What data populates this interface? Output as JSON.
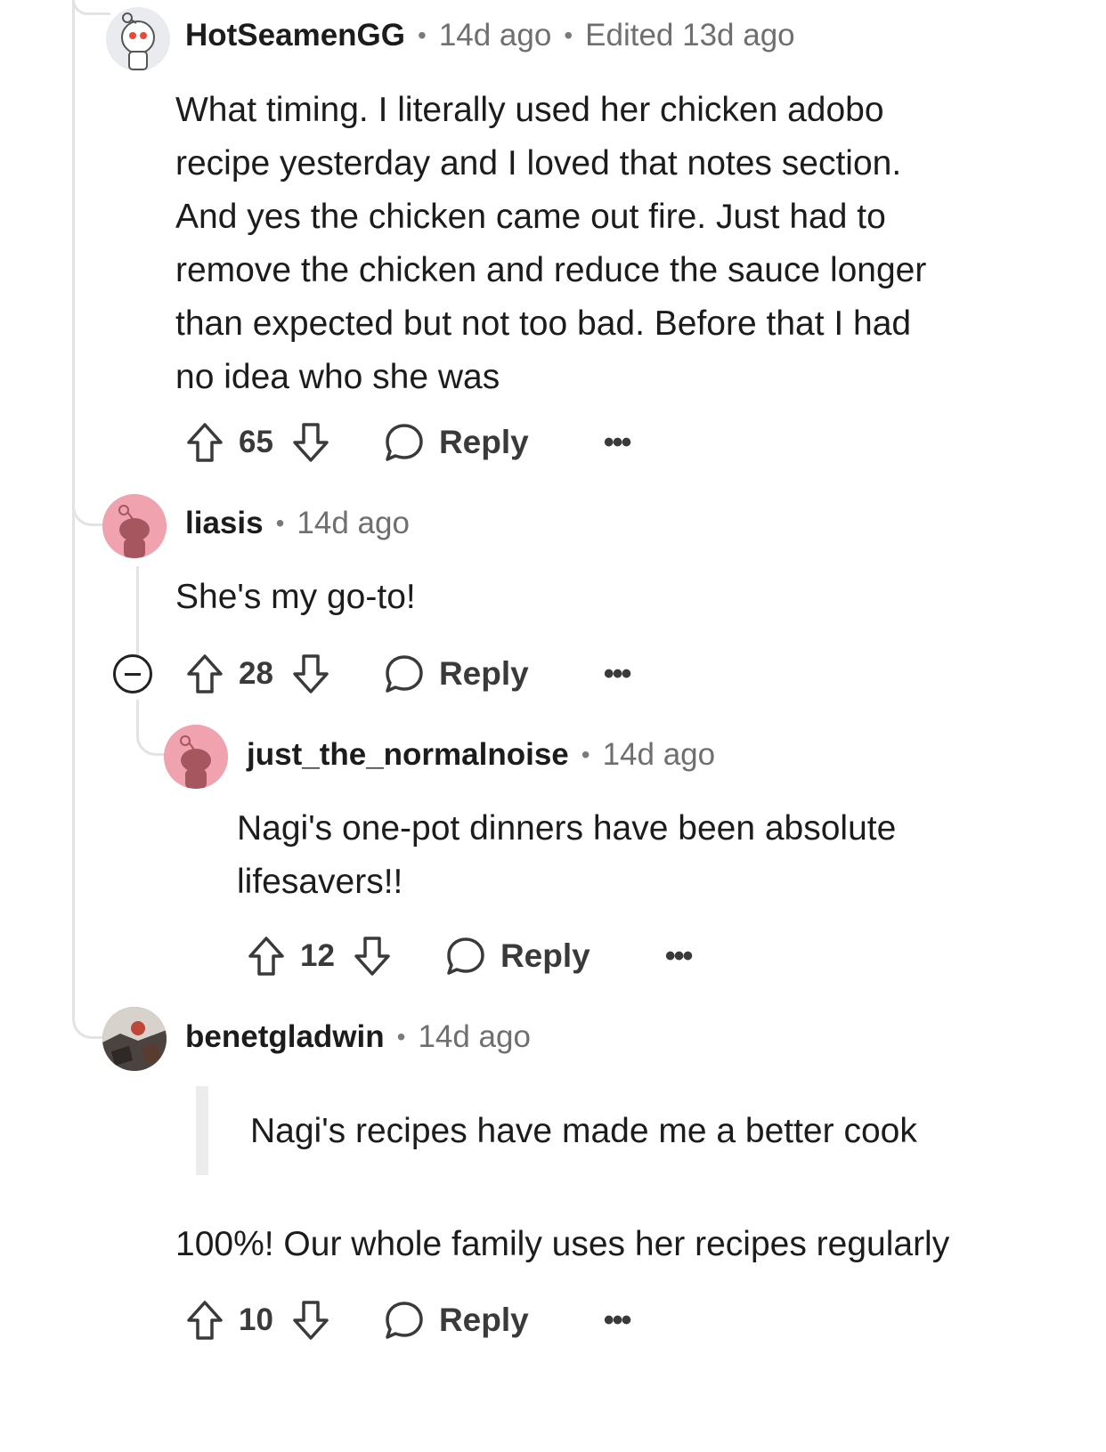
{
  "comments": [
    {
      "username": "HotSeamenGG",
      "time": "14d ago",
      "edited": "Edited 13d ago",
      "body": [
        "What timing. I literally used her chicken adobo",
        "recipe yesterday and I loved that notes section.",
        "And yes the chicken came out fire. Just had to",
        "remove the chicken and reduce the sauce longer",
        "than expected but not too bad. Before that I had",
        "no idea who she was"
      ],
      "score": "65",
      "reply_label": "Reply",
      "more": "•••",
      "avatar_icon": "snoo-robot-avatar"
    },
    {
      "username": "liasis",
      "time": "14d ago",
      "body": [
        "She's my go-to!"
      ],
      "score": "28",
      "reply_label": "Reply",
      "more": "•••",
      "avatar_icon": "snoo-pink-avatar"
    },
    {
      "username": "just_the_normalnoise",
      "time": "14d ago",
      "body": [
        "Nagi's one-pot dinners have been absolute",
        "lifesavers!!"
      ],
      "score": "12",
      "reply_label": "Reply",
      "more": "•••",
      "avatar_icon": "snoo-pink-avatar"
    },
    {
      "username": "benetgladwin",
      "time": "14d ago",
      "quote": "Nagi's recipes have made me a better cook",
      "body": [
        "100%! Our whole family uses her recipes regularly"
      ],
      "score": "10",
      "reply_label": "Reply",
      "more": "•••",
      "avatar_icon": "photo-avatar"
    }
  ],
  "colors": {
    "thread_line": "#e3e3e3",
    "avatar_pink": "#f0a2ae",
    "snoo_body": "#a5565f",
    "text": "#1c1c1c",
    "meta": "#6f6f6f"
  }
}
